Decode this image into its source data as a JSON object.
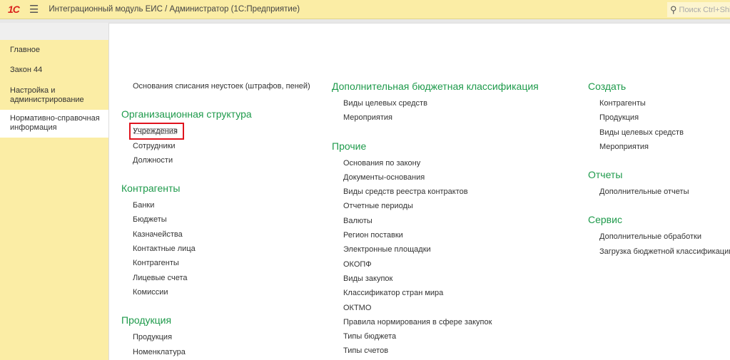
{
  "header": {
    "title": "Интеграционный модуль ЕИС / Администратор  (1С:Предприятие)",
    "search_placeholder": "Поиск Ctrl+Shift+F",
    "logo": "1С"
  },
  "sidebar": {
    "items": [
      {
        "label": "Главное"
      },
      {
        "label": "Закон 44"
      },
      {
        "label": "Настройка и администрирование"
      },
      {
        "label": "Нормативно-справочная информация"
      }
    ]
  },
  "col1": {
    "top_item": "Основания списания неустоек (штрафов, пеней)",
    "groups": [
      {
        "title": "Организационная структура",
        "items": [
          "Учреждения",
          "Сотрудники",
          "Должности"
        ]
      },
      {
        "title": "Контрагенты",
        "items": [
          "Банки",
          "Бюджеты",
          "Казначейства",
          "Контактные лица",
          "Контрагенты",
          "Лицевые счета",
          "Комиссии"
        ]
      },
      {
        "title": "Продукция",
        "items": [
          "Продукция",
          "Номенклатура"
        ]
      }
    ]
  },
  "col2": {
    "groups": [
      {
        "title": "Дополнительная бюджетная классификация",
        "items": [
          "Виды целевых средств",
          "Мероприятия"
        ]
      },
      {
        "title": "Прочие",
        "items": [
          "Основания по закону",
          "Документы-основания",
          "Виды средств реестра контрактов",
          "Отчетные периоды",
          "Валюты",
          "Регион поставки",
          "Электронные площадки",
          "ОКОПФ",
          "Виды закупок",
          "Классификатор стран мира",
          "ОКТМО",
          "Правила нормирования в сфере закупок",
          "Типы бюджета",
          "Типы счетов"
        ]
      }
    ]
  },
  "col3": {
    "groups": [
      {
        "title": "Создать",
        "items": [
          "Контрагенты",
          "Продукция",
          "Виды целевых средств",
          "Мероприятия"
        ]
      },
      {
        "title": "Отчеты",
        "items": [
          "Дополнительные отчеты"
        ]
      },
      {
        "title": "Сервис",
        "items": [
          "Дополнительные обработки",
          "Загрузка бюджетной классификации"
        ]
      }
    ]
  }
}
